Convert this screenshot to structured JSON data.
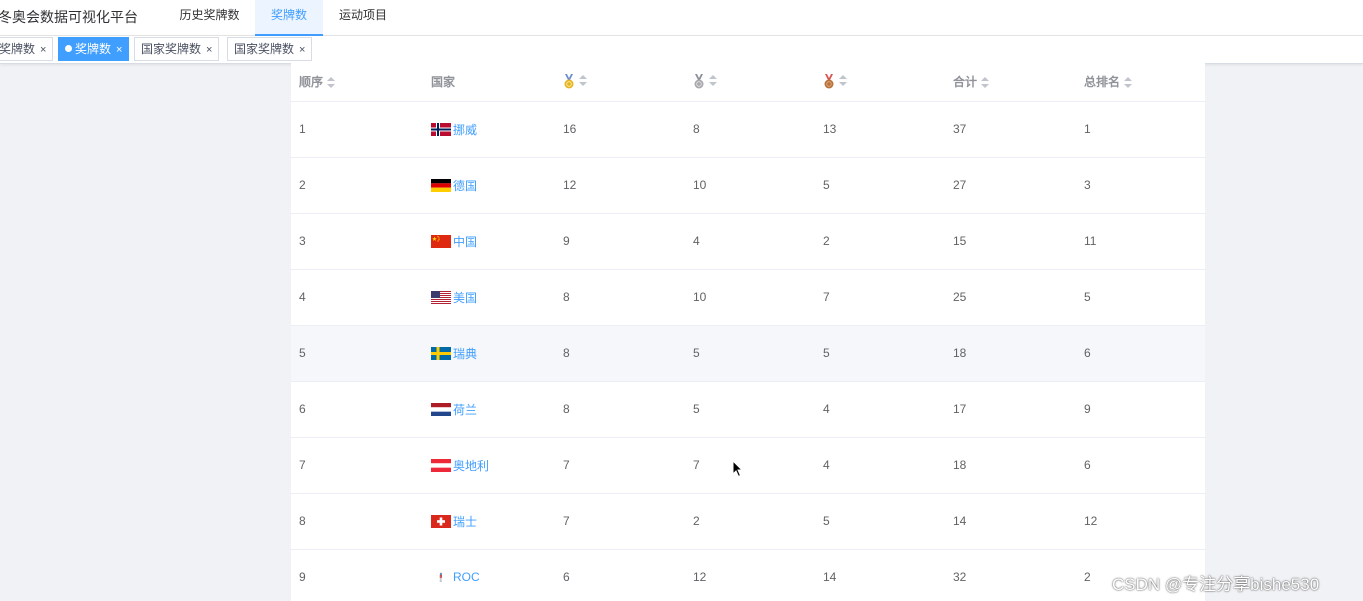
{
  "app": {
    "title": "冬奥会数据可视化平台"
  },
  "nav": [
    {
      "label": "历史奖牌数",
      "active": false
    },
    {
      "label": "奖牌数",
      "active": true
    },
    {
      "label": "运动项目",
      "active": false
    }
  ],
  "tags": [
    {
      "label": "奖牌数",
      "active": false,
      "close": "×"
    },
    {
      "label": "奖牌数",
      "active": true,
      "close": "×"
    },
    {
      "label": "国家奖牌数",
      "active": false,
      "close": "×"
    },
    {
      "label": "国家奖牌数",
      "active": false,
      "close": "×"
    }
  ],
  "table": {
    "columns": [
      {
        "key": "rank",
        "label": "顺序"
      },
      {
        "key": "country",
        "label": "国家"
      },
      {
        "key": "gold",
        "icon": "gold-medal-icon",
        "color": "#e6b422"
      },
      {
        "key": "silver",
        "icon": "silver-medal-icon",
        "color": "#a8a9ad"
      },
      {
        "key": "bronze",
        "icon": "bronze-medal-icon",
        "color": "#b8733a"
      },
      {
        "key": "total",
        "label": "合计"
      },
      {
        "key": "overall_rank",
        "label": "总排名"
      }
    ],
    "rows": [
      {
        "rank": "1",
        "country": "挪威",
        "flag": "norway-flag-icon",
        "gold": "16",
        "silver": "8",
        "bronze": "13",
        "total": "37",
        "overall_rank": "1"
      },
      {
        "rank": "2",
        "country": "德国",
        "flag": "germany-flag-icon",
        "gold": "12",
        "silver": "10",
        "bronze": "5",
        "total": "27",
        "overall_rank": "3"
      },
      {
        "rank": "3",
        "country": "中国",
        "flag": "china-flag-icon",
        "gold": "9",
        "silver": "4",
        "bronze": "2",
        "total": "15",
        "overall_rank": "11"
      },
      {
        "rank": "4",
        "country": "美国",
        "flag": "usa-flag-icon",
        "gold": "8",
        "silver": "10",
        "bronze": "7",
        "total": "25",
        "overall_rank": "5"
      },
      {
        "rank": "5",
        "country": "瑞典",
        "flag": "sweden-flag-icon",
        "gold": "8",
        "silver": "5",
        "bronze": "5",
        "total": "18",
        "overall_rank": "6"
      },
      {
        "rank": "6",
        "country": "荷兰",
        "flag": "netherlands-flag-icon",
        "gold": "8",
        "silver": "5",
        "bronze": "4",
        "total": "17",
        "overall_rank": "9"
      },
      {
        "rank": "7",
        "country": "奥地利",
        "flag": "austria-flag-icon",
        "gold": "7",
        "silver": "7",
        "bronze": "4",
        "total": "18",
        "overall_rank": "6"
      },
      {
        "rank": "8",
        "country": "瑞士",
        "flag": "switzerland-flag-icon",
        "gold": "7",
        "silver": "2",
        "bronze": "5",
        "total": "14",
        "overall_rank": "12"
      },
      {
        "rank": "9",
        "country": "ROC",
        "flag": "roc-flag-icon",
        "gold": "6",
        "silver": "12",
        "bronze": "14",
        "total": "32",
        "overall_rank": "2"
      }
    ]
  },
  "colors": {
    "accent": "#409eff",
    "header_text": "#909399",
    "cell_text": "#606266",
    "page_bg": "#f0f2f5"
  },
  "watermark": "CSDN @专注分享bishe530"
}
